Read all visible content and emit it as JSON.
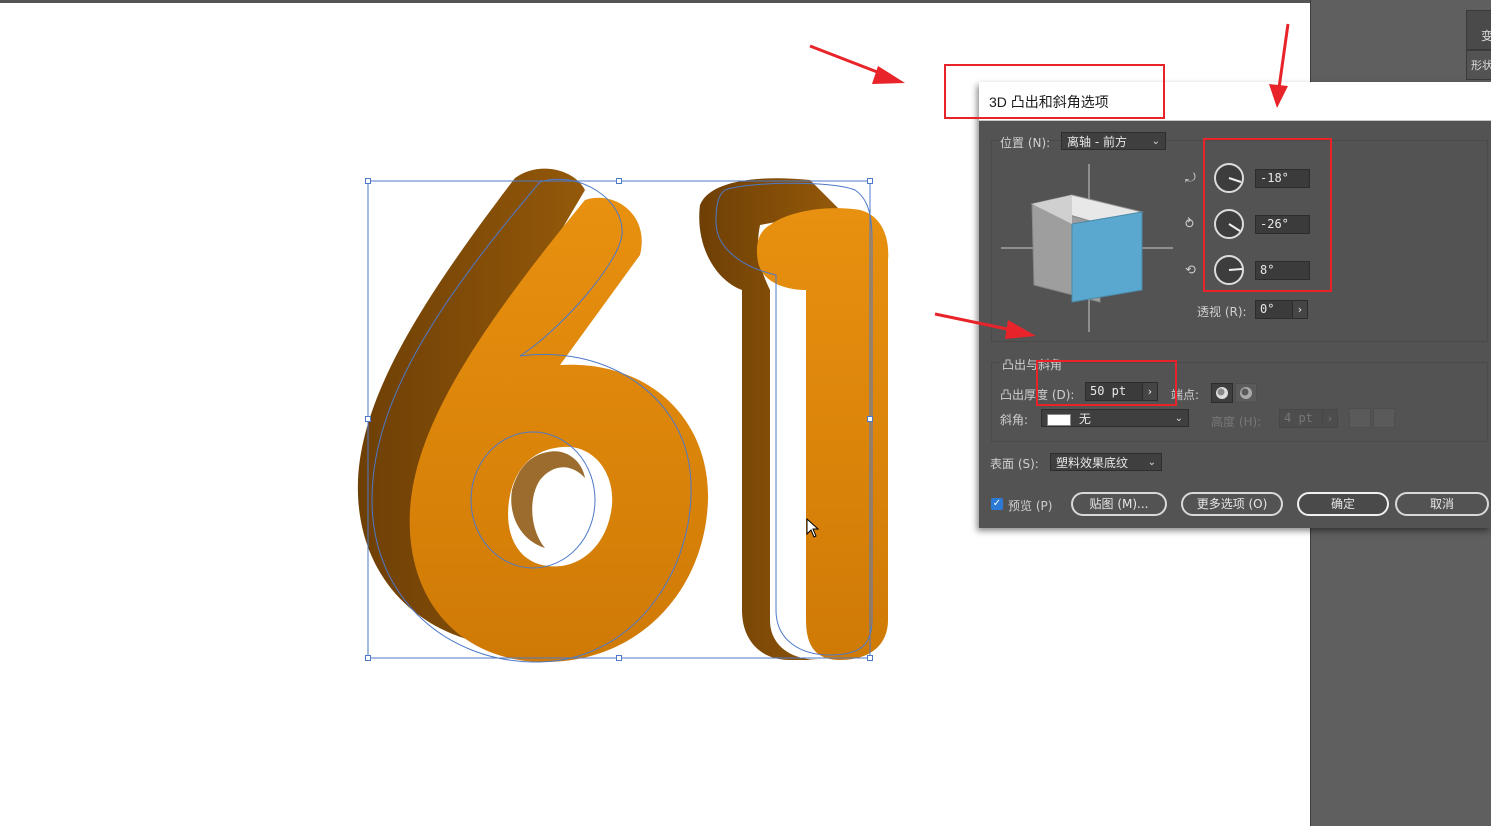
{
  "canvas": {
    "background": "#ffffff"
  },
  "dialog": {
    "title": "3D 凸出和斜角选项",
    "position_label": "位置 (N):",
    "position_value": "离轴 - 前方",
    "rotation": {
      "x": "-18°",
      "y": "-26°",
      "z": "8°"
    },
    "perspective_label": "透视 (R):",
    "perspective_value": "0°",
    "extrude_section": "凸出与斜角",
    "extrude_depth_label": "凸出厚度 (D):",
    "extrude_depth_value": "50 pt",
    "cap_label": "端点:",
    "bevel_label": "斜角:",
    "bevel_value": "无",
    "height_label": "高度 (H):",
    "height_value": "4 pt",
    "surface_label": "表面 (S):",
    "surface_value": "塑料效果底纹",
    "preview_label": "预览 (P)",
    "preview_checked": true,
    "map_button": "贴图 (M)...",
    "more_button": "更多选项 (O)",
    "ok_button": "确定",
    "cancel_button": "取消"
  },
  "right_panel": {
    "tab_label": "变",
    "tab2_label": "形状"
  },
  "colors": {
    "accent_red": "#e8242a",
    "extrusion_face": "#e08a0e",
    "extrusion_side": "#8a5208",
    "cube_front": "#5aa8cf",
    "selection_blue": "#4d79c9"
  }
}
